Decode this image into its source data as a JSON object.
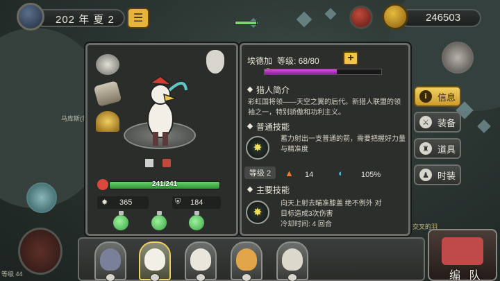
{
  "top_bar": {
    "year_label": "202 年 夏 2",
    "coins": "246503",
    "menu_icon": "menu-icon"
  },
  "hero": {
    "name": "埃德加",
    "level_label": "等级: 68/80",
    "xp_progress": 0.62,
    "hp_text": "241/241",
    "hp_fraction": 1.0,
    "attack": "365",
    "defense": "184"
  },
  "sections": {
    "intro_title": "猎人简介",
    "intro_text": "彩虹国将领——天空之翼的后代。新猎人联盟的领袖之一，特别骄傲和功利主义。",
    "normal_skill_title": "普通技能",
    "normal_skill_text": "蓄力射出一支普通的箭，需要把握好力量与精准度",
    "skill_level": "等级 2",
    "skill_stat_1": "14",
    "skill_stat_2": "105%",
    "main_skill_title": "主要技能",
    "main_skill_text_1": "向天上射去瞄准膝盖 绝不例外 对",
    "main_skill_text_2": "目标造成3次伤害",
    "main_skill_text_3": "冷却时间: 4 回合"
  },
  "side_tabs": [
    {
      "label": "信息",
      "icon": "info-icon",
      "active": true
    },
    {
      "label": "装备",
      "icon": "equipment-icon",
      "active": false
    },
    {
      "label": "道具",
      "icon": "item-bag-icon",
      "active": false
    },
    {
      "label": "时装",
      "icon": "costume-icon",
      "active": false
    }
  ],
  "bottom": {
    "team_label": "编 队",
    "left_tag_1": "马库斯(第",
    "left_tag_2": "等级 44",
    "right_tag": "交叉的羽"
  },
  "colors": {
    "accent_gold": "#f0c644",
    "hp_green": "#4cc24f",
    "xp_purple": "#b33cc4"
  }
}
